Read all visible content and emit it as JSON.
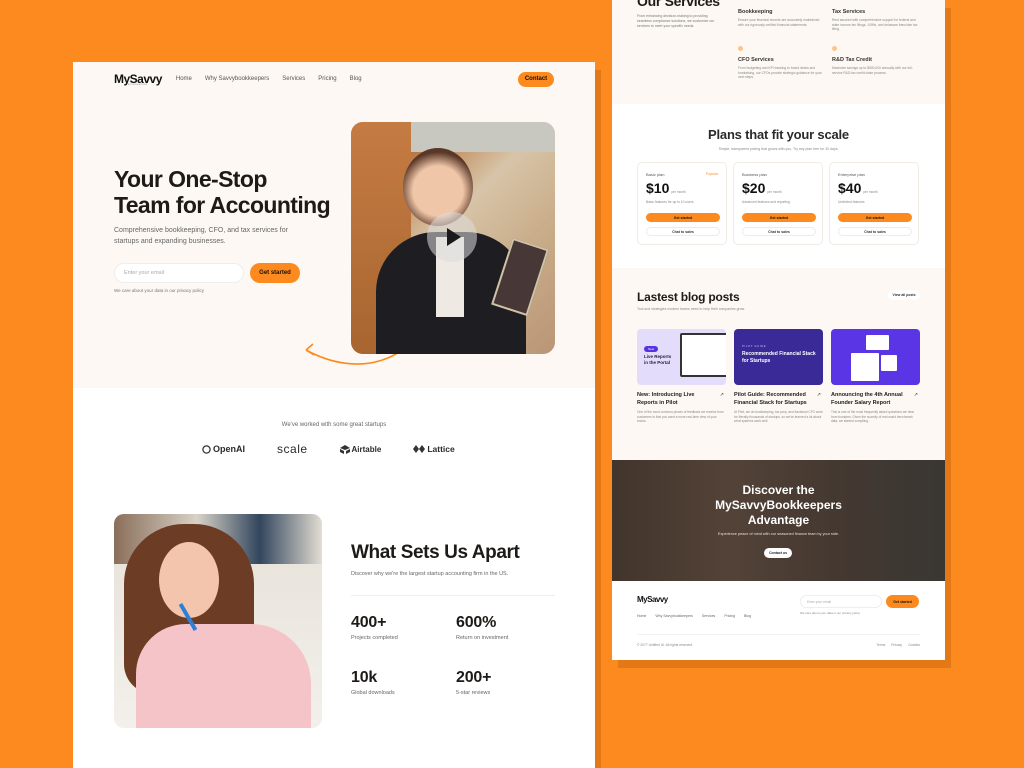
{
  "brand": {
    "name": "MySavvy",
    "tagline": "BOOKKEEPERS",
    "accent": "#FC8A1E",
    "background": "#FC8A1E"
  },
  "nav": {
    "links": [
      "Home",
      "Why Savvybookkeepers",
      "Services",
      "Pricing",
      "Blog"
    ],
    "contact": "Contact"
  },
  "hero": {
    "title_line1": "Your One-Stop",
    "title_line2": "Team for Accounting",
    "description": "Comprehensive bookkeeping, CFO, and tax services for startups and expanding businesses.",
    "email_placeholder": "Enter your email",
    "cta": "Get started",
    "privacy": "We care about your data in our privacy policy",
    "video_icon": "play-icon"
  },
  "partners": {
    "caption": "We've worked with some great startups",
    "logos": [
      "OpenAI",
      "scale",
      "Airtable",
      "Lattice"
    ]
  },
  "apart": {
    "title": "What Sets Us Apart",
    "description": "Discover why we're the largest startup accounting firm in the US.",
    "stats": [
      {
        "value": "400+",
        "label": "Projects completed"
      },
      {
        "value": "600%",
        "label": "Return on investment"
      },
      {
        "value": "10k",
        "label": "Global downloads"
      },
      {
        "value": "200+",
        "label": "5-star reviews"
      }
    ]
  },
  "services": {
    "title": "Our Services",
    "description": "From enhancing decision-making to providing seamless compliance solutions, we customize our services to meet your specific needs.",
    "items": [
      {
        "title": "Bookkeeping",
        "text": "Ensure your financial records are accurately maintained with our rigorously verified financial statements."
      },
      {
        "title": "Tax Services",
        "text": "Rest assured with comprehensive support for federal and state income tax filings, 1099s, and delaware franchise tax filing."
      },
      {
        "title": "CFO Services",
        "text": "From budgeting and KPI tracking to board decks and fundraising, our CFOs provide strategic guidance for your next steps."
      },
      {
        "title": "R&D Tax Credit",
        "text": "Maximize savings up to $500,000 annually with our full-service R&D tax credit claim process."
      }
    ]
  },
  "plans": {
    "title": "Plans that fit your scale",
    "description": "Simple, transparent pricing that grows with you. Try any plan free for 30 days.",
    "per": "per month",
    "popular": "Popular",
    "get_started": "Get started",
    "chat": "Chat to sales",
    "items": [
      {
        "name": "Basic plan",
        "price": "$10",
        "feature": "Basic features for up to 10 users"
      },
      {
        "name": "Business plan",
        "price": "$20",
        "feature": "Advanced features and reporting"
      },
      {
        "name": "Enterprise plan",
        "price": "$40",
        "feature": "Unlimited features"
      }
    ]
  },
  "blog": {
    "title": "Lastest blog posts",
    "description": "Tool and strategies modern teams need to help their companies grow.",
    "view_all": "View all posts",
    "posts": [
      {
        "badge": "New",
        "image_text": "Live Reports in the Portal",
        "title": "New: Introducing Live Reports in Pilot",
        "excerpt": "One of the most common pieces of feedback we receive from customers is that you want a more real-time view of your books."
      },
      {
        "kicker": "PILOT GUIDE",
        "image_text": "Recommended Financial Stack for Startups",
        "title": "Pilot Guide: Recommended Financial Stack for Startups",
        "excerpt": "At Pilot, we do bookkeeping, tax prep, and fractional CFO work for literally thousands of startups, so we've learned a lot about what systems work well."
      },
      {
        "title": "Announcing the 4th Annual Founder Salary Report",
        "excerpt": "This is one of the most frequently asked questions we hear from founders. Given the scarcity of real world benchmark data, we started compiling."
      }
    ]
  },
  "cta": {
    "title_line1": "Discover the",
    "title_line2": "MySavvyBookkeepers",
    "title_line3": "Advantage",
    "description": "Experience peace of mind with our seasoned finance team by your side.",
    "button": "Contact us"
  },
  "footer": {
    "links": [
      "Home",
      "Why Savvybookkeepers",
      "Services",
      "Pricing",
      "Blog"
    ],
    "email_placeholder": "Enter your email",
    "cta": "Get started",
    "privacy": "We care about your data in our privacy policy",
    "copyright": "© 2077 Untitled UI. All rights reserved.",
    "legal": [
      "Terms",
      "Privacy",
      "Cookies"
    ]
  }
}
